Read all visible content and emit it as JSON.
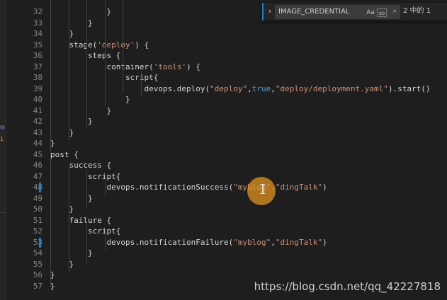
{
  "find_widget": {
    "search_value": "IMAGE_CREDENTIAL",
    "match_case_label": "Aa",
    "whole_word_label": "ab",
    "regex_label": ".*",
    "match_count": "2 中的 1"
  },
  "activity_badges": {
    "m": "M",
    "one": "1"
  },
  "code_lines": [
    {
      "num": "32",
      "parts": [
        {
          "t": "            }",
          "c": ""
        }
      ]
    },
    {
      "num": "33",
      "parts": [
        {
          "t": "        }",
          "c": ""
        }
      ]
    },
    {
      "num": "34",
      "parts": [
        {
          "t": "    }",
          "c": ""
        }
      ]
    },
    {
      "num": "35",
      "parts": [
        {
          "t": "    stage(",
          "c": ""
        },
        {
          "t": "'deploy'",
          "c": "str"
        },
        {
          "t": ") {",
          "c": ""
        }
      ]
    },
    {
      "num": "36",
      "parts": [
        {
          "t": "        steps {",
          "c": ""
        }
      ]
    },
    {
      "num": "37",
      "parts": [
        {
          "t": "            container(",
          "c": ""
        },
        {
          "t": "'tools'",
          "c": "str"
        },
        {
          "t": ") {",
          "c": ""
        }
      ]
    },
    {
      "num": "38",
      "parts": [
        {
          "t": "                script{",
          "c": ""
        }
      ]
    },
    {
      "num": "39",
      "parts": [
        {
          "t": "                    devops.deploy(",
          "c": ""
        },
        {
          "t": "\"deploy\"",
          "c": "str"
        },
        {
          "t": ",",
          "c": ""
        },
        {
          "t": "true",
          "c": "kw"
        },
        {
          "t": ",",
          "c": ""
        },
        {
          "t": "\"deploy/deployment.yaml\"",
          "c": "str"
        },
        {
          "t": ").start()",
          "c": ""
        }
      ]
    },
    {
      "num": "40",
      "parts": [
        {
          "t": "                }",
          "c": ""
        }
      ]
    },
    {
      "num": "41",
      "parts": [
        {
          "t": "            }",
          "c": ""
        }
      ]
    },
    {
      "num": "42",
      "parts": [
        {
          "t": "        }",
          "c": ""
        }
      ]
    },
    {
      "num": "43",
      "parts": [
        {
          "t": "    }",
          "c": ""
        }
      ]
    },
    {
      "num": "44",
      "parts": [
        {
          "t": "}",
          "c": ""
        }
      ]
    },
    {
      "num": "45",
      "parts": [
        {
          "t": "post {",
          "c": ""
        }
      ]
    },
    {
      "num": "46",
      "parts": [
        {
          "t": "    success {",
          "c": ""
        }
      ]
    },
    {
      "num": "47",
      "parts": [
        {
          "t": "        script{",
          "c": ""
        }
      ]
    },
    {
      "num": "48",
      "parts": [
        {
          "t": "            devops.notificationSuccess(",
          "c": ""
        },
        {
          "t": "\"myblog\"",
          "c": "str"
        },
        {
          "t": ",",
          "c": ""
        },
        {
          "t": "\"dingTalk\"",
          "c": "str"
        },
        {
          "t": ")",
          "c": ""
        }
      ]
    },
    {
      "num": "49",
      "parts": [
        {
          "t": "        }",
          "c": ""
        }
      ]
    },
    {
      "num": "50",
      "parts": [
        {
          "t": "    }",
          "c": ""
        }
      ]
    },
    {
      "num": "51",
      "parts": [
        {
          "t": "    failure {",
          "c": ""
        }
      ]
    },
    {
      "num": "52",
      "parts": [
        {
          "t": "        script{",
          "c": ""
        }
      ]
    },
    {
      "num": "53",
      "parts": [
        {
          "t": "            devops.notificationFailure(",
          "c": ""
        },
        {
          "t": "\"myblog\"",
          "c": "str"
        },
        {
          "t": ",",
          "c": ""
        },
        {
          "t": "\"dingTalk\"",
          "c": "str"
        },
        {
          "t": ")",
          "c": ""
        }
      ]
    },
    {
      "num": "54",
      "parts": [
        {
          "t": "        }",
          "c": ""
        }
      ]
    },
    {
      "num": "55",
      "parts": [
        {
          "t": "    }",
          "c": ""
        }
      ]
    },
    {
      "num": "56",
      "parts": [
        {
          "t": "}",
          "c": ""
        }
      ]
    },
    {
      "num": "57",
      "parts": [
        {
          "t": "}",
          "c": ""
        }
      ]
    }
  ],
  "modified_lines": [
    "48",
    "53"
  ],
  "watermark": "https://blog.csdn.net/qq_42227818"
}
